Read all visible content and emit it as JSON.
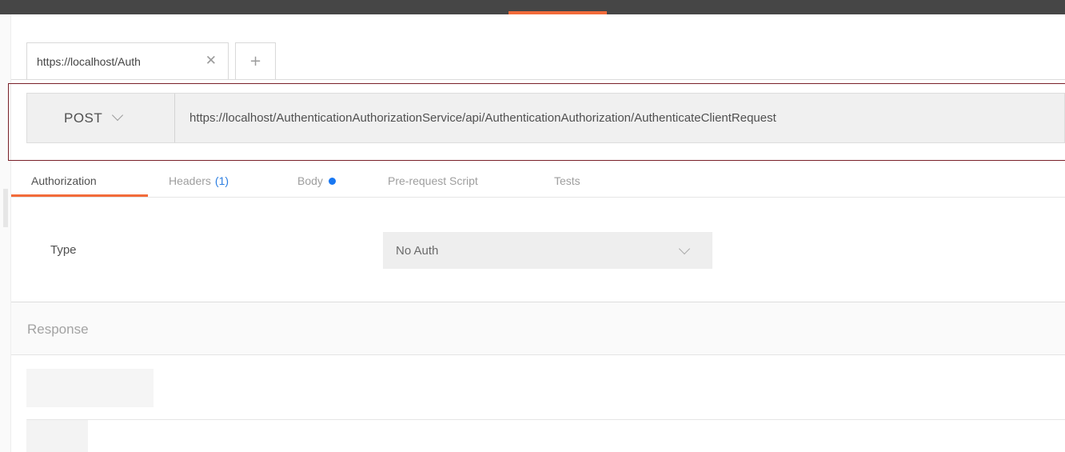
{
  "tabs": [
    {
      "label": "https://localhost/Auth",
      "close_icon": "close-icon"
    }
  ],
  "add_tab_icon": "plus-icon",
  "request": {
    "method": "POST",
    "url": "https://localhost/AuthenticationAuthorizationService/api/AuthenticationAuthorization/AuthenticateClientRequest"
  },
  "subtabs": {
    "authorization": "Authorization",
    "headers": "Headers",
    "headers_count": "(1)",
    "body": "Body",
    "prerequest": "Pre-request Script",
    "tests": "Tests"
  },
  "auth": {
    "type_label": "Type",
    "type_value": "No Auth"
  },
  "response": {
    "label": "Response"
  },
  "colors": {
    "accent": "#f26b3a",
    "highlight_border": "#7a2129",
    "headers_count": "#2a7de1",
    "body_dot": "#1877f2",
    "topbar": "#464646"
  }
}
